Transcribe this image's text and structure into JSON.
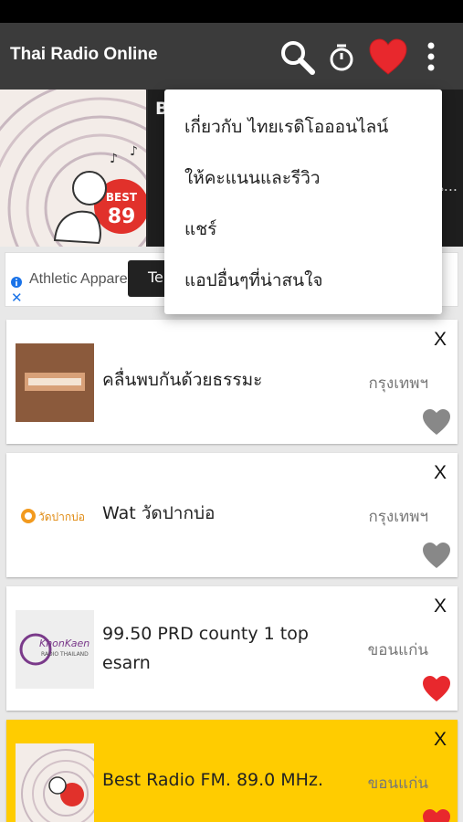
{
  "app": {
    "title": "Thai Radio Online"
  },
  "toolbar": {
    "icons": [
      "search-icon",
      "timer-icon",
      "favorite-heart-icon",
      "more-vert-icon"
    ]
  },
  "now_playing": {
    "title_initial": "B",
    "ellipsis": "น...",
    "logo_text": "BEST FM 89"
  },
  "ad": {
    "text": "Athletic Appare",
    "pill_text": "Te",
    "close": "✕"
  },
  "menu": {
    "items": [
      "เกี่ยวกับ ไทยเรดิโอออนไลน์",
      "ให้คะแนนและรีวิว",
      "แชร์",
      "แอปอื่นๆที่น่าสนใจ"
    ]
  },
  "stations": [
    {
      "name": "คลื่นพบกันด้วยธรรมะ",
      "city": "กรุงเทพฯ",
      "close": "X",
      "favorite": false,
      "thumb_color": "#8b5a3c"
    },
    {
      "name": "Wat วัดปากบ่อ",
      "city": "กรุงเทพฯ",
      "close": "X",
      "favorite": false,
      "thumb_text": "วัดปากบ่อ"
    },
    {
      "name": "99.50 PRD county 1 top esarn",
      "city": "ขอนแก่น",
      "close": "X",
      "favorite": true,
      "thumb_text": "KhonKaen",
      "thumb_subtext": "RADIO THAILAND"
    },
    {
      "name": "Best Radio FM. 89.0 MHz.",
      "city": "ขอนแก่น",
      "close": "X",
      "favorite": true,
      "highlighted": true
    }
  ],
  "colors": {
    "app_bar": "#3b3b3b",
    "heart_red": "#e8282d",
    "heart_gray": "#888888",
    "highlight": "#ffcc00"
  }
}
